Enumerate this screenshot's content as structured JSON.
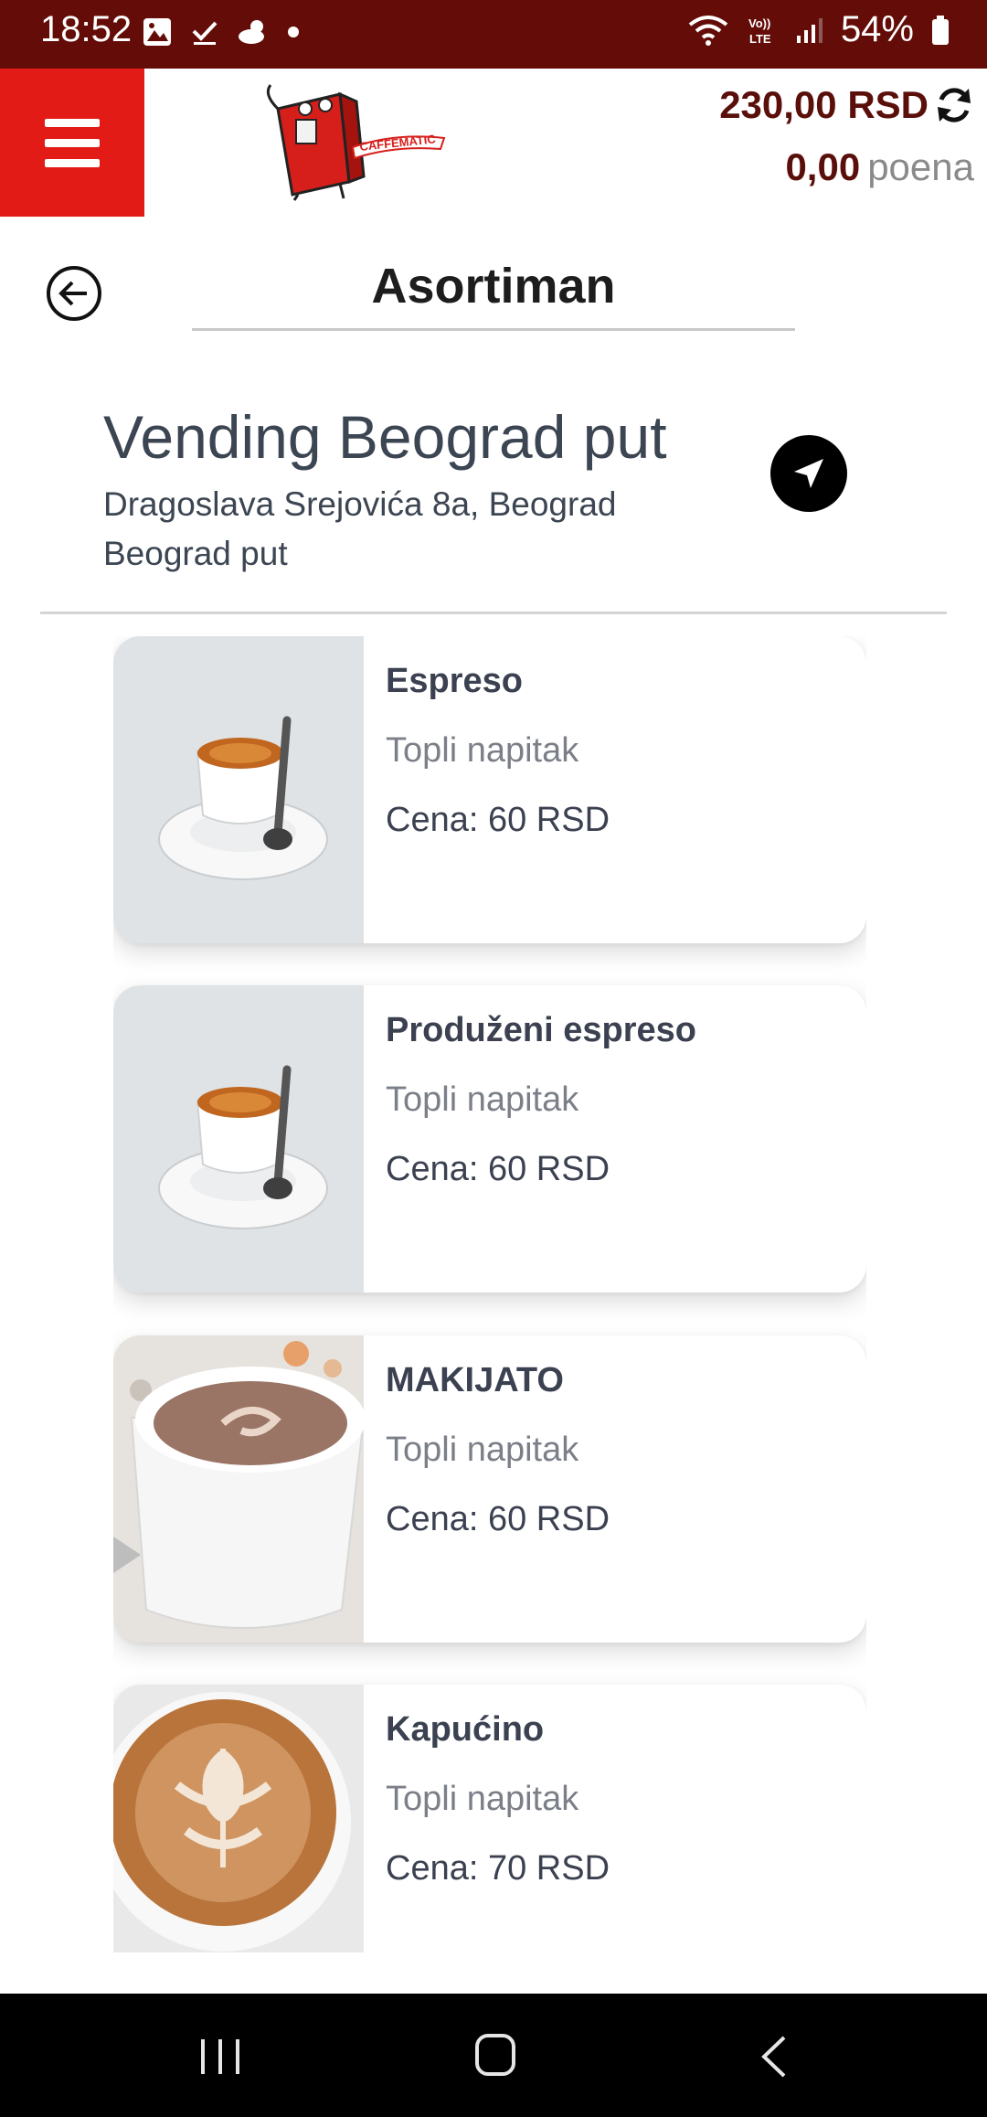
{
  "status_bar": {
    "time": "18:52",
    "battery": "54%"
  },
  "header": {
    "logo_text": "CAFFEMATIC",
    "balance": "230,00 RSD",
    "points_value": "0,00",
    "points_label": "poena"
  },
  "page": {
    "title": "Asortiman"
  },
  "location": {
    "name": "Vending Beograd put",
    "address": "Dragoslava Srejovića 8a, Beograd",
    "area": "Beograd put"
  },
  "products": [
    {
      "name": "Espreso",
      "category": "Topli napitak",
      "price": "Cena: 60 RSD",
      "image": "espresso-cup"
    },
    {
      "name": "Produženi espreso",
      "category": "Topli napitak",
      "price": "Cena: 60 RSD",
      "image": "espresso-cup"
    },
    {
      "name": "MAKIJATO",
      "category": "Topli napitak",
      "price": "Cena: 60 RSD",
      "image": "macchiato-cup"
    },
    {
      "name": "Kapućino",
      "category": "Topli napitak",
      "price": "Cena: 70 RSD",
      "image": "cappuccino-cup"
    }
  ],
  "colors": {
    "status_bar": "#640d08",
    "menu_button": "#e31b17",
    "balance_text": "#5a0f0a"
  }
}
